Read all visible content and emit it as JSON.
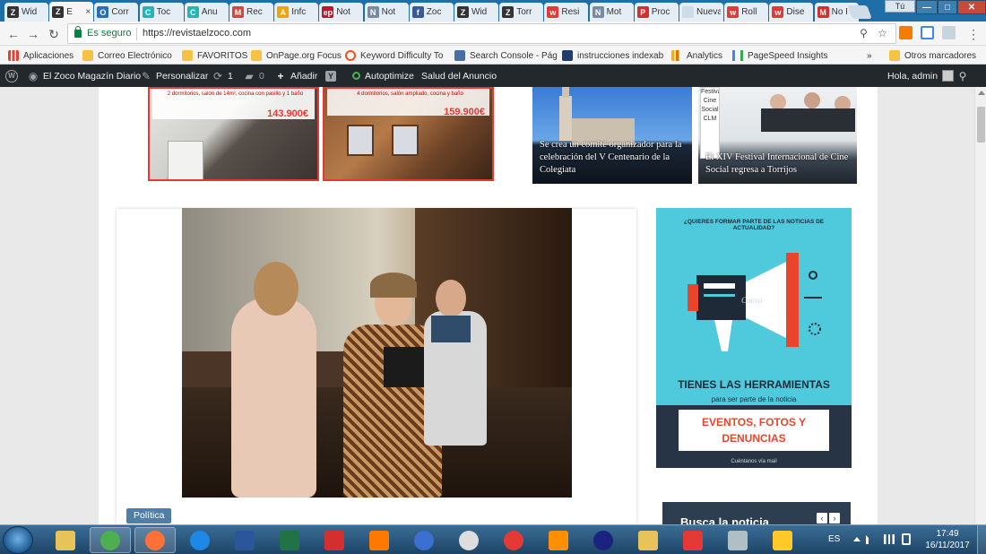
{
  "browser": {
    "tabs": [
      {
        "label": "Wid",
        "icon": "Z",
        "color": "#333333"
      },
      {
        "label": "E",
        "icon": "Z",
        "color": "#333333",
        "active": true
      },
      {
        "label": "Corr",
        "icon": "O",
        "color": "#2a6ebb"
      },
      {
        "label": "Toc",
        "icon": "C",
        "color": "#23b5b5"
      },
      {
        "label": "Anu",
        "icon": "C",
        "color": "#23b5b5"
      },
      {
        "label": "Rec",
        "icon": "M",
        "color": "#d44638"
      },
      {
        "label": "Infc",
        "icon": "A",
        "color": "#f4a300"
      },
      {
        "label": "Not",
        "icon": "ep",
        "color": "#c8102e"
      },
      {
        "label": "Not",
        "icon": "N",
        "color": "#7a8aa0"
      },
      {
        "label": "Zoc",
        "icon": "f",
        "color": "#3b5998"
      },
      {
        "label": "Wid",
        "icon": "Z",
        "color": "#333333"
      },
      {
        "label": "Torr",
        "icon": "Z",
        "color": "#333333"
      },
      {
        "label": "Resi",
        "icon": "w",
        "color": "#e53935"
      },
      {
        "label": "Mot",
        "icon": "N",
        "color": "#7a8aa0"
      },
      {
        "label": "Proc",
        "icon": "P",
        "color": "#d32f2f"
      },
      {
        "label": "Nueva p",
        "icon": "",
        "color": "#cfdbe6"
      },
      {
        "label": "Roll",
        "icon": "w",
        "color": "#e53935"
      },
      {
        "label": "Dise",
        "icon": "w",
        "color": "#e53935"
      },
      {
        "label": "No I",
        "icon": "M",
        "color": "#d32f2f"
      }
    ],
    "tab_close": "×",
    "user_chip": "Tú",
    "window_buttons": {
      "minimize": "—",
      "maximize": "□",
      "close": "✕"
    },
    "nav": {
      "back": "←",
      "forward": "→",
      "reload": "↻"
    },
    "secure_label": "Es seguro",
    "url": "https://revistaelzoco.com",
    "url_icons": {
      "zoom": "⚲",
      "star": "☆"
    },
    "menu_icon": "⋮",
    "bookmarks": [
      {
        "label": "Aplicaciones",
        "icon_color": "#e34133",
        "kind": "apps"
      },
      {
        "label": "Correo Electrónico",
        "icon_color": "#f6c244",
        "kind": "folder"
      },
      {
        "label": "FAVORITOS",
        "icon_color": "#f6c244",
        "kind": "folder"
      },
      {
        "label": "OnPage.org Focus",
        "icon_color": "#f6c244",
        "kind": "folder"
      },
      {
        "label": "Keyword Difficulty To",
        "icon_color": "#e8541e",
        "kind": "ring"
      },
      {
        "label": "Search Console - Pág",
        "icon_color": "#4a6fa5",
        "kind": "square"
      },
      {
        "label": "instrucciones indexab",
        "icon_color": "#233b6e",
        "kind": "square"
      },
      {
        "label": "Analytics",
        "icon_color": "#f9ab00",
        "kind": "bars"
      },
      {
        "label": "PageSpeed Insights",
        "icon_color": "#4285f4",
        "kind": "code"
      }
    ],
    "bookmarks_more": "»",
    "other_bookmarks": "Otros marcadores"
  },
  "admin_bar": {
    "wp_icon": "W",
    "site_name": "El Zoco Magazín Diario",
    "customize": "Personalizar",
    "updates_count": "1",
    "comments_count": "0",
    "add_new": "Añadir",
    "yoast": "Y",
    "autoptimize": "Autoptimize",
    "ad_health": "Salud del Anuncio",
    "greeting": "Hola, admin"
  },
  "page": {
    "ads": [
      {
        "price": "143.900€",
        "text": "2 dormitorios, salón de 14m², cocina con pasillo y 1 baño"
      },
      {
        "price": "159.900€",
        "text": "4 dormitorios, salón ampliado, cocina y baño"
      }
    ],
    "news": [
      {
        "caption": "Se crea un comité organizador para la celebración del V Centenario de la Colegiata"
      },
      {
        "caption": "El XIV Festival Internacional de Cine Social regresa a Torrijos",
        "sign_lines": [
          "Festival",
          "Cine",
          "Social",
          "CLM"
        ]
      }
    ],
    "article": {
      "category": "Política"
    },
    "banner": {
      "top_text": "¿QUIERES FORMAR PARTE DE LAS NOTICIAS DE ACTUALIDAD?",
      "brand": "Canva",
      "headline": "TIENES LAS HERRAMIENTAS",
      "sub": "para ser parte de la noticia",
      "box_line1": "EVENTOS, FOTOS Y",
      "box_line2": "DENUNCIAS",
      "footer": "Cuéntanos vía mail"
    },
    "search_widget": {
      "title": "Busca la noticia",
      "prev": "‹",
      "next": "›"
    }
  },
  "taskbar": {
    "apps": [
      {
        "name": "explorer",
        "color": "#e8c35a"
      },
      {
        "name": "chrome",
        "color": "#4caf50",
        "open": true
      },
      {
        "name": "firefox",
        "color": "#ff7139",
        "open": true
      },
      {
        "name": "internet-explorer",
        "color": "#1e88e5"
      },
      {
        "name": "word",
        "color": "#2b579a"
      },
      {
        "name": "excel",
        "color": "#217346"
      },
      {
        "name": "acrobat",
        "color": "#d32f2f"
      },
      {
        "name": "avast",
        "color": "#ff7800"
      },
      {
        "name": "malwarebytes",
        "color": "#3b6fd1"
      },
      {
        "name": "clock-app",
        "color": "#dddddd"
      },
      {
        "name": "red-app",
        "color": "#e53935"
      },
      {
        "name": "media-player",
        "color": "#ff8f00"
      },
      {
        "name": "user-app",
        "color": "#1a237e"
      },
      {
        "name": "folder-app",
        "color": "#e8c35a"
      },
      {
        "name": "paint-app",
        "color": "#e53935"
      },
      {
        "name": "printer",
        "color": "#b0bec5"
      },
      {
        "name": "palette",
        "color": "#ffca28"
      }
    ],
    "language": "ES",
    "time": "17:49",
    "date": "16/11/2017"
  }
}
